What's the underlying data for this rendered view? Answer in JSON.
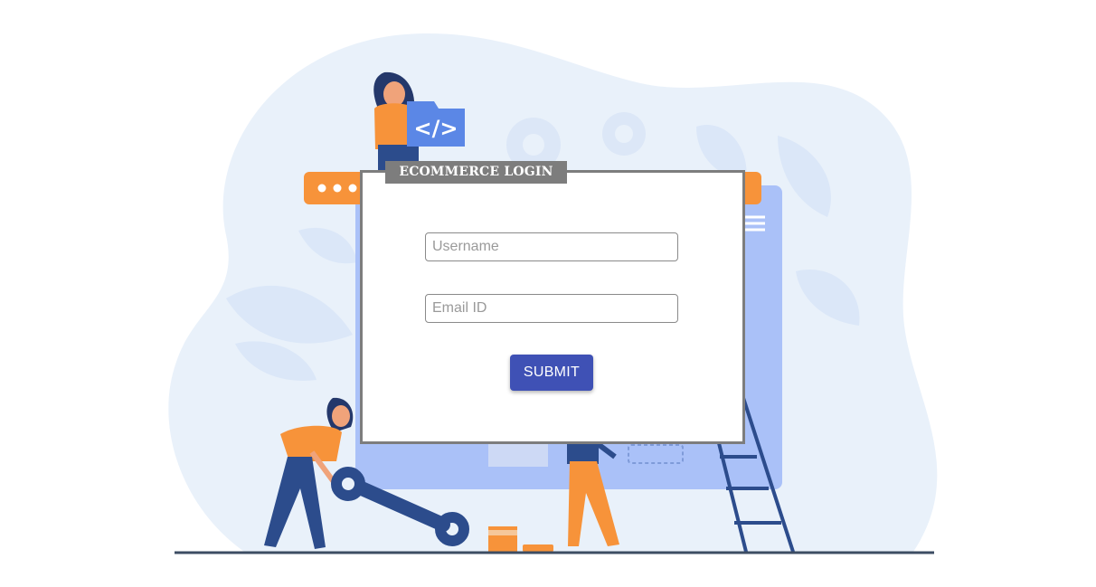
{
  "login": {
    "title": "ECOMMERCE LOGIN",
    "username_placeholder": "Username",
    "email_placeholder": "Email ID",
    "submit_label": "SUBMIT"
  },
  "illustration": {
    "code_tag_text": "</>"
  },
  "colors": {
    "primary": "#3f51b5",
    "card_border": "#7d7d7d",
    "illustration_blob": "#e8f0fa",
    "illustration_window": "#a9c0f7",
    "illustration_orange": "#f7933a",
    "illustration_navy": "#2c4c8c"
  }
}
